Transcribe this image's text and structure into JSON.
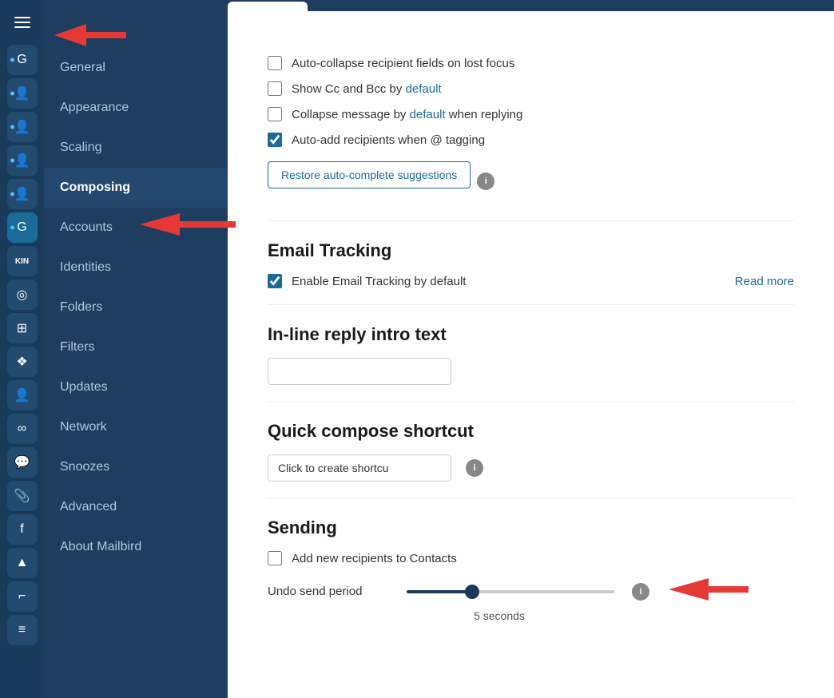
{
  "sidebar": {
    "items": [
      {
        "id": "general",
        "label": "General",
        "active": false
      },
      {
        "id": "appearance",
        "label": "Appearance",
        "active": false
      },
      {
        "id": "scaling",
        "label": "Scaling",
        "active": false
      },
      {
        "id": "composing",
        "label": "Composing",
        "active": true
      },
      {
        "id": "accounts",
        "label": "Accounts",
        "active": false
      },
      {
        "id": "identities",
        "label": "Identities",
        "active": false
      },
      {
        "id": "folders",
        "label": "Folders",
        "active": false
      },
      {
        "id": "filters",
        "label": "Filters",
        "active": false
      },
      {
        "id": "updates",
        "label": "Updates",
        "active": false
      },
      {
        "id": "network",
        "label": "Network",
        "active": false
      },
      {
        "id": "snoozes",
        "label": "Snoozes",
        "active": false
      },
      {
        "id": "advanced",
        "label": "Advanced",
        "active": false
      },
      {
        "id": "about",
        "label": "About Mailbird",
        "active": false
      }
    ]
  },
  "checkboxes": {
    "auto_collapse": {
      "label": "Auto-collapse recipient fields on lost focus",
      "checked": false
    },
    "show_cc_bcc": {
      "label_pre": "Show Cc and Bcc by ",
      "label_highlight": "default",
      "checked": false
    },
    "collapse_message": {
      "label_pre": "Collapse message by ",
      "label_highlight": "default",
      "label_post": " when replying",
      "checked": false
    },
    "auto_add": {
      "label": "Auto-add recipients when @ tagging",
      "checked": true
    }
  },
  "restore_button": {
    "label": "Restore auto-complete suggestions"
  },
  "email_tracking": {
    "title": "Email Tracking",
    "enable_label": "Enable Email Tracking by default",
    "checked": true,
    "read_more": "Read more"
  },
  "inline_reply": {
    "title": "In-line reply intro text",
    "placeholder": ""
  },
  "quick_compose": {
    "title": "Quick compose shortcut",
    "placeholder": "Click to create shortcu"
  },
  "sending": {
    "title": "Sending",
    "add_recipients_label": "Add new recipients to Contacts",
    "add_recipients_checked": false,
    "undo_send_label": "Undo send period",
    "undo_send_value": 30,
    "undo_send_seconds": "5 seconds"
  },
  "icons": {
    "hamburger": "☰",
    "info": "i",
    "g_icon": "G",
    "person_icon": "👤"
  }
}
